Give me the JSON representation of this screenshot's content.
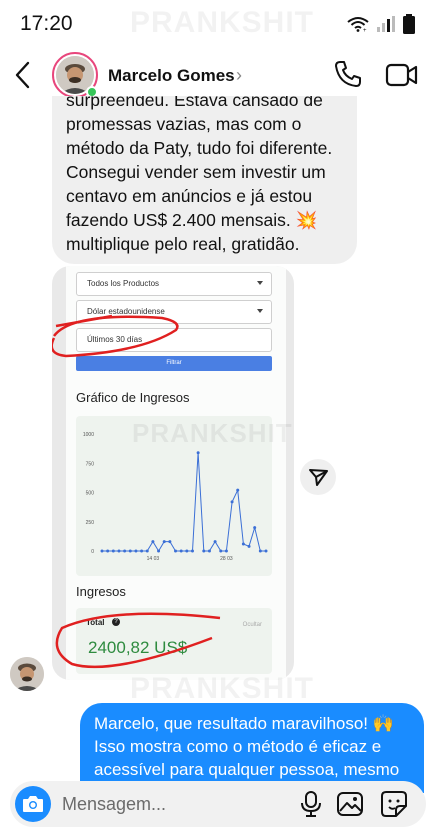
{
  "status_bar": {
    "time": "17:20"
  },
  "watermark": "PRANKSHIT",
  "header": {
    "contact_name": "Marcelo Gomes",
    "chevron": "›"
  },
  "incoming_message": {
    "text": "surpreendeu. Estava cansado de\npromessas vazias, mas com o\nmétodo da Paty, tudo foi diferente.\nConsegui vender sem investir um\ncentavo em anúncios e já estou\nfazendo US$ 2.400 mensais. 💥\nmultiplique pelo real, gratidão."
  },
  "shared_screenshot": {
    "product_select": "Todos los Productos",
    "currency_select": "Dólar estadounidense",
    "range_select": "Últimos 30 días",
    "filter_button": "Filtrar",
    "chart_title": "Gráfico de Ingresos",
    "income_title": "Ingresos",
    "total_label": "Total",
    "hide_label": "Ocultar",
    "total_value": "2400,82 US$",
    "chart_data": {
      "type": "line",
      "title": "Gráfico de Ingresos",
      "ylim": [
        0,
        1000
      ],
      "y_ticks": [
        0,
        250,
        500,
        750,
        1000
      ],
      "x_tick_labels": [
        {
          "index": 9,
          "label": "14 03"
        },
        {
          "index": 22,
          "label": "28 03"
        }
      ],
      "series": [
        {
          "color": "#3b6fd6",
          "values": [
            0,
            0,
            0,
            0,
            0,
            0,
            0,
            0,
            0,
            80,
            0,
            80,
            80,
            0,
            0,
            0,
            0,
            840,
            0,
            0,
            80,
            0,
            0,
            420,
            520,
            60,
            40,
            200,
            0,
            0
          ]
        }
      ]
    }
  },
  "outgoing_message": {
    "text": "Marcelo, que resultado maravilhoso! 🙌 Isso mostra como o método é eficaz e acessível para qualquer pessoa, mesmo"
  },
  "composer": {
    "placeholder": "Mensagem..."
  },
  "colors": {
    "accent_blue": "#1a8cff",
    "story_ring": "#e8467c",
    "online": "#36c659",
    "total_green": "#2e8b3f",
    "annotation_red": "#e02020"
  },
  "icons": [
    "wifi-icon",
    "signal-icon",
    "battery-icon",
    "back-icon",
    "phone-icon",
    "video-icon",
    "send-icon",
    "camera-icon",
    "mic-icon",
    "gallery-icon",
    "sticker-icon"
  ]
}
